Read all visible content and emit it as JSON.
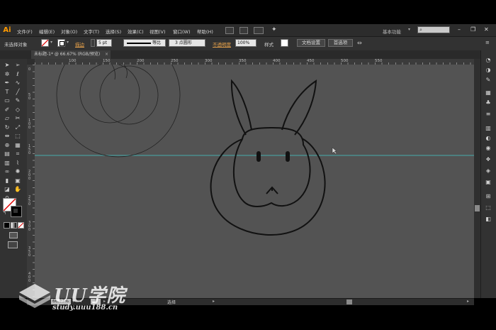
{
  "app": {
    "logo": "Ai"
  },
  "menu": {
    "items": [
      "文件(F)",
      "编辑(E)",
      "对象(O)",
      "文字(T)",
      "选择(S)",
      "效果(C)",
      "视图(V)",
      "窗口(W)",
      "帮助(H)"
    ],
    "workspace": "基本功能",
    "window_controls": [
      "–",
      "❐",
      "✕"
    ]
  },
  "control_bar": {
    "selection": "未选择对象",
    "stroke_label": "描边",
    "stroke_value": "5 pt",
    "stroke_style": "等比",
    "brush": "3 点圆形",
    "opacity_label": "不透明度",
    "opacity_value": "100%",
    "style_label": "样式",
    "doc_setup_button": "文档设置",
    "prefs_button": "首选项"
  },
  "document_tab": {
    "title": "未标题-1* @ 66.67% (RGB/预览)",
    "close": "×"
  },
  "rulers": {
    "top": [
      "100",
      "150",
      "200",
      "250",
      "300",
      "350",
      "400",
      "450",
      "500",
      "550"
    ],
    "left": [
      "0",
      "50",
      "100",
      "150",
      "200",
      "250",
      "300",
      "350",
      "400",
      "450"
    ]
  },
  "status_bar": {
    "zoom": "66.67%",
    "page": "1",
    "tool_status": "选择"
  },
  "watermark": {
    "title": "UU学院",
    "url": "study.uuu188.cn"
  },
  "colors": {
    "canvas": "#535353",
    "guide": "#3fc9c9",
    "fill_swatch": "#ffffff",
    "stroke_swatch": "#000000",
    "accent": "#ff9a00"
  },
  "icons": {
    "tools": [
      "selection-arrow",
      "direct-selection",
      "magic-wand",
      "lasso",
      "pen",
      "curvature",
      "type",
      "line-segment",
      "rectangle",
      "paintbrush",
      "pencil",
      "shaper",
      "eraser",
      "scissors",
      "rotate",
      "scale",
      "width",
      "free-transform",
      "shape-builder",
      "live-paint",
      "perspective-grid",
      "mesh",
      "gradient",
      "eyedropper",
      "blend",
      "symbol-sprayer",
      "column-graph",
      "artboard",
      "slice",
      "hand",
      "zoom"
    ],
    "right_panel": [
      "color",
      "color-guide",
      "brushes",
      "swatches",
      "symbols",
      "stroke",
      "gradient",
      "transparency",
      "appearance",
      "graphic-styles",
      "layers",
      "artboards",
      "align",
      "transform",
      "pathfinder"
    ]
  }
}
